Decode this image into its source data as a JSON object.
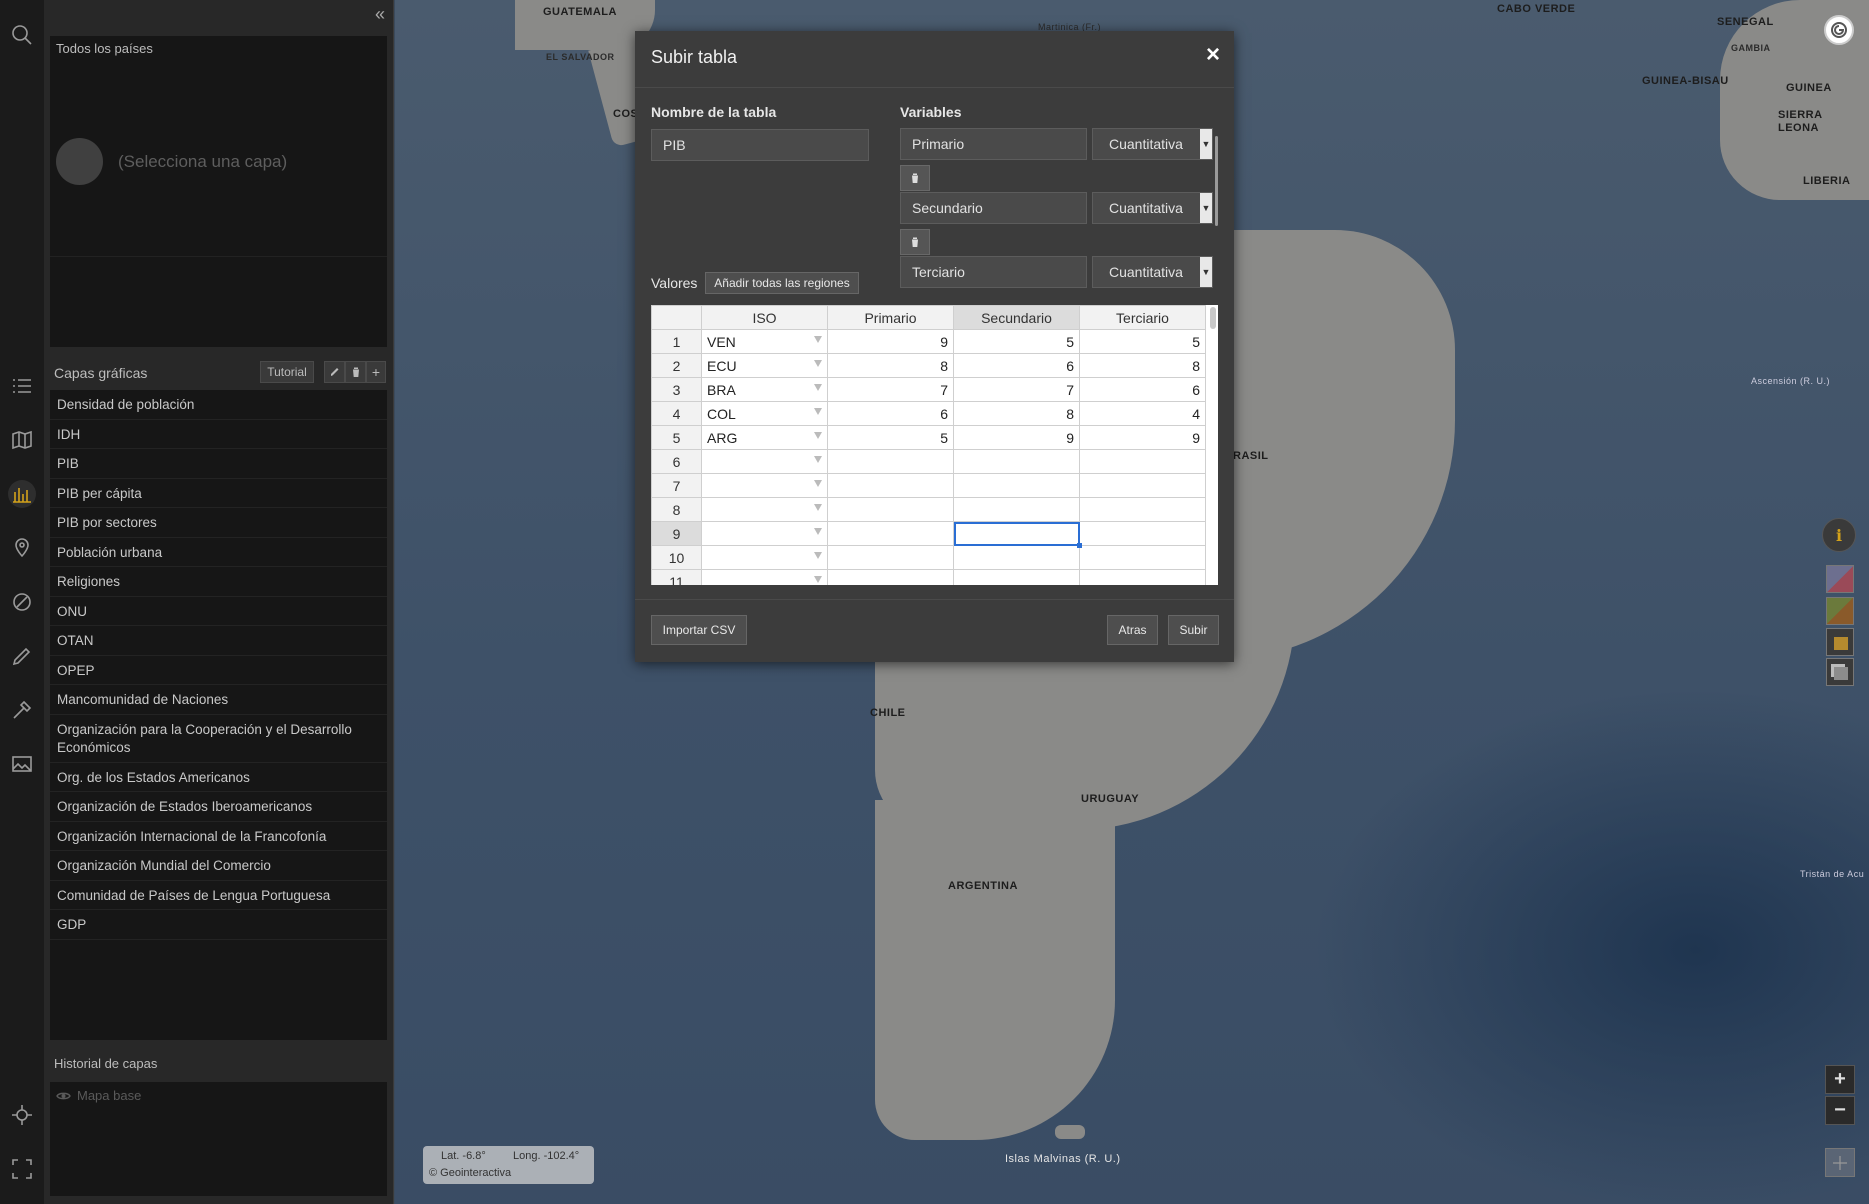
{
  "map": {
    "labels": {
      "guatemala": "GUATEMALA",
      "el_salvador": "EL SALVADOR",
      "costa_rica": "COS",
      "martinica": "Martinica (Fr.)",
      "cabo_verde": "CABO VERDE",
      "senegal": "SENEGAL",
      "gambia": "GAMBIA",
      "guinea_bisau": "GUINEA-BISAU",
      "guinea": "GUINEA",
      "sierra_leona": "SIERRA LEONA",
      "liberia": "LIBERIA",
      "ascension": "Ascensión (R. U.)",
      "brasil": "RASIL",
      "chile": "CHILE",
      "uruguay": "URUGUAY",
      "argentina": "ARGENTINA",
      "tristan": "Tristán de Acu",
      "malvinas": "Islas Malvinas (R. U.)"
    },
    "coords": {
      "lat": "Lat. -6.8°",
      "long": "Long. -102.4°",
      "credit": "© Geointeractiva"
    },
    "colors": {
      "swatches": [
        "#8a5a6e",
        "#6b7a3c",
        "#b58a2e",
        "#8c8c8c"
      ]
    }
  },
  "sidebar": {
    "info_box": {
      "title": "Todos los países",
      "placeholder": "(Selecciona una capa)"
    },
    "layers": {
      "title": "Capas gráficas",
      "tutorial_label": "Tutorial",
      "items": [
        "Densidad de población",
        "IDH",
        "PIB",
        "PIB per cápita",
        "PIB por sectores",
        "Población urbana",
        "Religiones",
        "ONU",
        "OTAN",
        "OPEP",
        "Mancomunidad de Naciones",
        "Organización para la Cooperación y el Desarrollo Económicos",
        "Org. de los Estados Americanos",
        "Organización de Estados Iberoamericanos",
        "Organización Internacional de la Francofonía",
        "Organización Mundial del Comercio",
        "Comunidad de Países de Lengua Portuguesa",
        "GDP"
      ]
    },
    "history": {
      "title": "Historial de capas",
      "items": [
        "Mapa base"
      ]
    }
  },
  "modal": {
    "title": "Subir tabla",
    "close_label": "×",
    "table_name_label": "Nombre de la tabla",
    "table_name_value": "PIB",
    "variables_label": "Variables",
    "variables": [
      {
        "name": "Primario",
        "type": "Cuantitativa"
      },
      {
        "name": "Secundario",
        "type": "Cuantitativa"
      },
      {
        "name": "Terciario",
        "type": "Cuantitativa"
      }
    ],
    "values_label": "Valores",
    "add_regions_label": "Añadir todas las regiones",
    "grid": {
      "headers": [
        "ISO",
        "Primario",
        "Secundario",
        "Terciario"
      ],
      "rows": [
        {
          "n": "1",
          "iso": "VEN",
          "p": "9",
          "s": "5",
          "t": "5"
        },
        {
          "n": "2",
          "iso": "ECU",
          "p": "8",
          "s": "6",
          "t": "8"
        },
        {
          "n": "3",
          "iso": "BRA",
          "p": "7",
          "s": "7",
          "t": "6"
        },
        {
          "n": "4",
          "iso": "COL",
          "p": "6",
          "s": "8",
          "t": "4"
        },
        {
          "n": "5",
          "iso": "ARG",
          "p": "5",
          "s": "9",
          "t": "9"
        },
        {
          "n": "6",
          "iso": "",
          "p": "",
          "s": "",
          "t": ""
        },
        {
          "n": "7",
          "iso": "",
          "p": "",
          "s": "",
          "t": ""
        },
        {
          "n": "8",
          "iso": "",
          "p": "",
          "s": "",
          "t": ""
        },
        {
          "n": "9",
          "iso": "",
          "p": "",
          "s": "",
          "t": ""
        },
        {
          "n": "10",
          "iso": "",
          "p": "",
          "s": "",
          "t": ""
        },
        {
          "n": "11",
          "iso": "",
          "p": "",
          "s": "",
          "t": ""
        }
      ]
    },
    "import_csv_label": "Importar CSV",
    "back_label": "Atras",
    "submit_label": "Subir"
  }
}
